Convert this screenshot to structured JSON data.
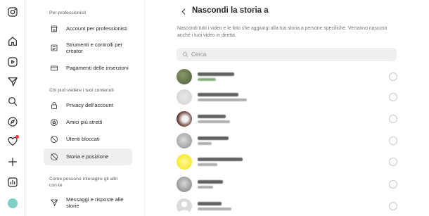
{
  "rail": {
    "icons": [
      "instagram-icon",
      "home-icon",
      "reels-icon",
      "messages-icon",
      "search-icon",
      "explore-icon",
      "notifications-icon",
      "create-icon",
      "dashboard-icon",
      "profile-avatar"
    ]
  },
  "settings": {
    "sections": [
      {
        "title": "Per professionisti",
        "items": [
          {
            "label": "Account per professionisti",
            "icon": "store-icon"
          },
          {
            "label": "Strumenti e controlli per creator",
            "icon": "tools-icon"
          },
          {
            "label": "Pagamenti delle inserzioni",
            "icon": "card-icon"
          }
        ]
      },
      {
        "title": "Chi può vedere i tuoi contenuti",
        "items": [
          {
            "label": "Privacy dell'account",
            "icon": "lock-icon"
          },
          {
            "label": "Amici più stretti",
            "icon": "star-icon"
          },
          {
            "label": "Utenti bloccati",
            "icon": "blocked-icon"
          },
          {
            "label": "Storia e posizione",
            "icon": "story-off-icon",
            "active": true
          }
        ]
      },
      {
        "title": "Come possono interagire gli altri con te",
        "items": [
          {
            "label": "Messaggi e risposte alle storie",
            "icon": "send-icon"
          }
        ]
      }
    ]
  },
  "main": {
    "title": "Nascondi la storia a",
    "description": "Nascondi tutti i video e le foto che aggiungi alla tua storia a persone specifiche. Verranno nascosti anche i tuoi video in diretta.",
    "search_placeholder": "Cerca"
  },
  "colors": {
    "notification_dot": "#ff3040",
    "avatar": "#7fd0c6",
    "active_item_bg": "#efefef"
  }
}
